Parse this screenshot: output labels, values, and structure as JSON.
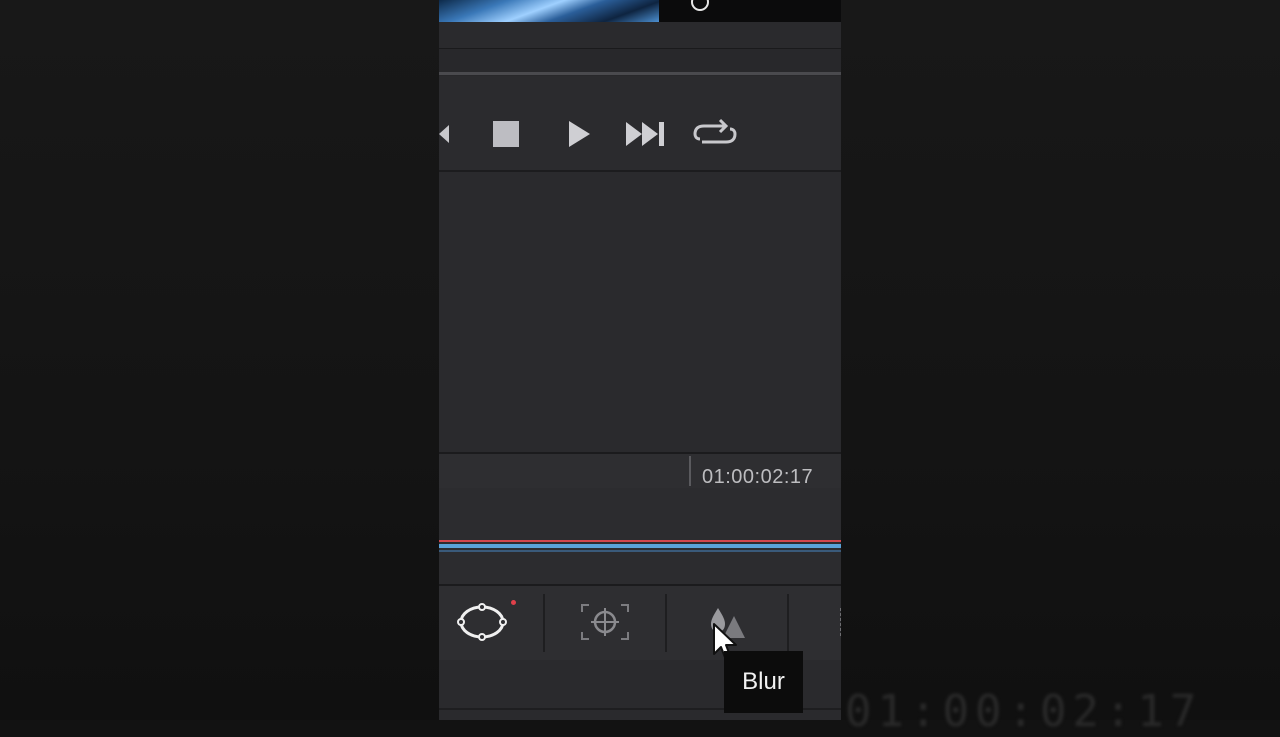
{
  "timeline": {
    "timecode": "01:00:02:17"
  },
  "toolbar": {
    "tools": [
      {
        "name": "power-window-tool",
        "icon": "circle-window-icon",
        "active": true
      },
      {
        "name": "tracker-tool",
        "icon": "crosshair-icon"
      },
      {
        "name": "blur-tool",
        "icon": "blur-drops-icon"
      },
      {
        "name": "key-tool",
        "icon": "key-icon"
      }
    ]
  },
  "tooltip": {
    "text": "Blur"
  },
  "background": {
    "ghost_timecode": "01:00:02:17"
  },
  "colors": {
    "panel": "#28282b",
    "accent_red": "#d2464d",
    "accent_blue": "#5aa2d8",
    "tooltip_bg": "#0c0c0c"
  }
}
